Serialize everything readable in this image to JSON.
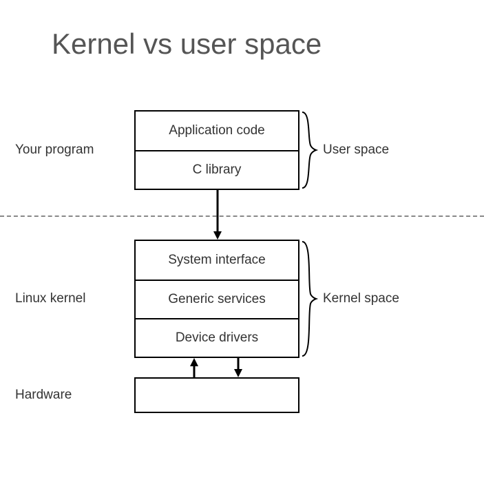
{
  "title": "Kernel vs user space",
  "labels": {
    "program": "Your program",
    "kernel": "Linux kernel",
    "hardware": "Hardware",
    "userspace": "User space",
    "kernelspace": "Kernel space"
  },
  "stack": {
    "user": {
      "app": "Application code",
      "clib": "C library"
    },
    "kernel": {
      "iface": "System interface",
      "generic": "Generic services",
      "drivers": "Device drivers"
    }
  }
}
